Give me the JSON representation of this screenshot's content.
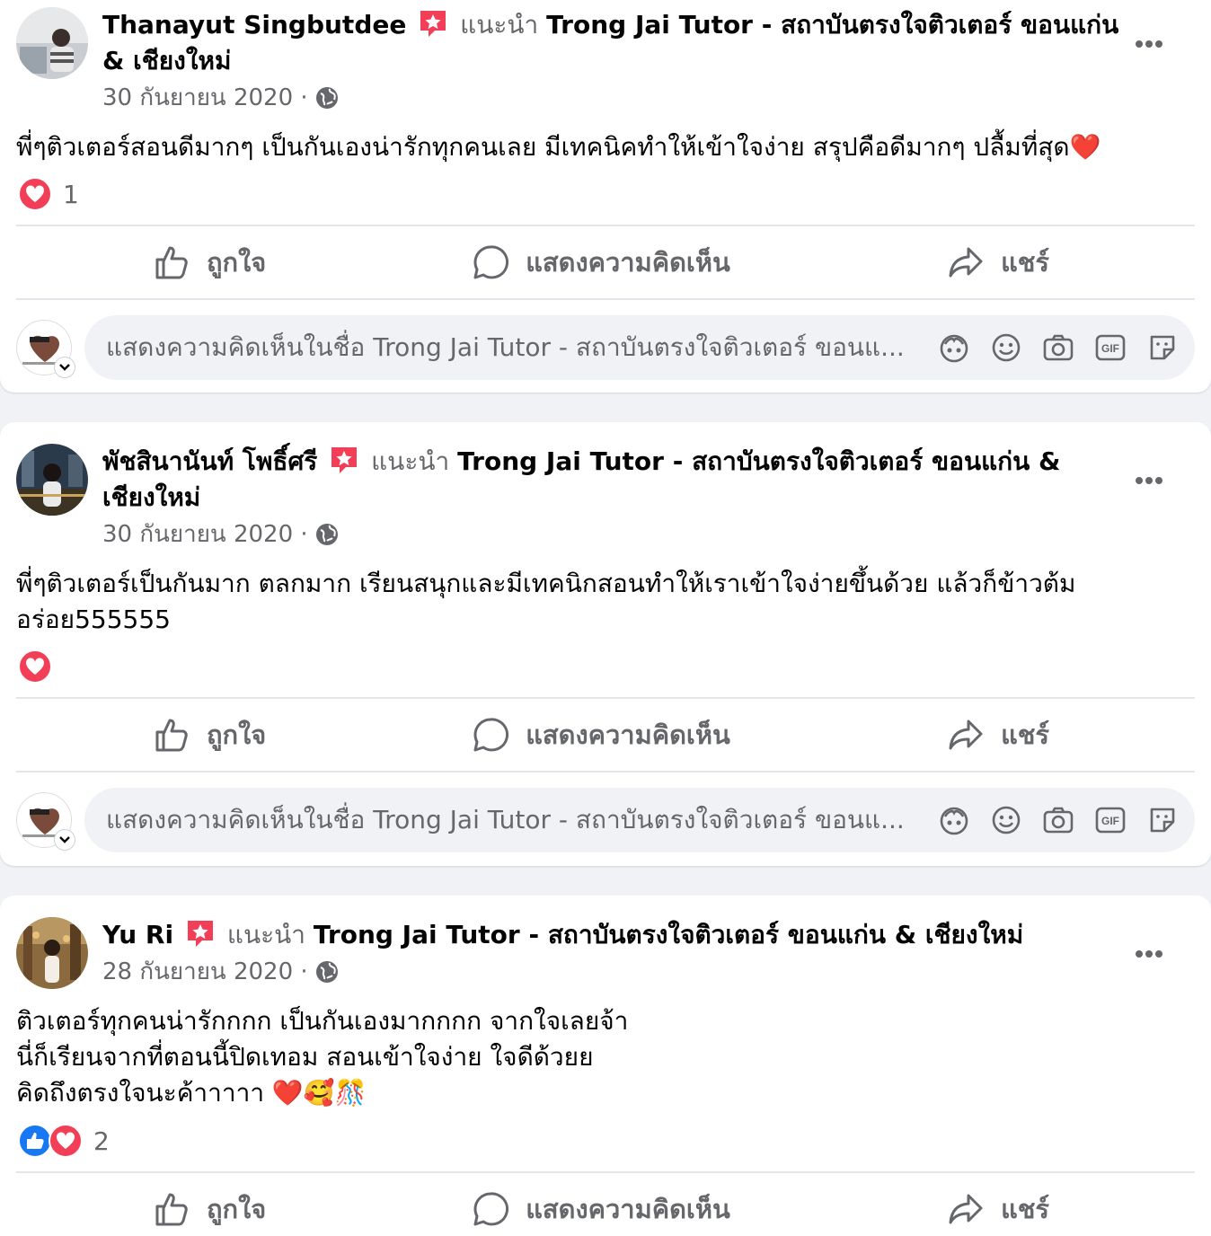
{
  "labels": {
    "recommends": "แนะนำ",
    "page_name": "Trong Jai Tutor - สถาบันตรงใจติวเตอร์ ขอนแก่น & เชียงใหม่",
    "like": "ถูกใจ",
    "comment": "แสดงความคิดเห็น",
    "share": "แชร์",
    "composer_placeholder": "แสดงความคิดเห็นในชื่อ Trong Jai Tutor - สถาบันตรงใจติวเตอร์ ขอนแ..."
  },
  "posts": [
    {
      "author": "Thanayut Singbutdee",
      "date": "30 กันยายน 2020 ·",
      "text": "พี่ๆติวเตอร์สอนดีมากๆ เป็นกันเองน่ารักทุกคนเลย มีเทคนิคทำให้เข้าใจง่าย สรุปคือดีมากๆ ปลื้มที่สุด❤️",
      "reactions": [
        "love"
      ],
      "reaction_count": "1"
    },
    {
      "author": "พัชสินานันท์ โพธิ์ศรี",
      "date": "30 กันยายน 2020 ·",
      "text": "พี่ๆติวเตอร์เป็นกันมาก ตลกมาก เรียนสนุกและมีเทคนิกสอนทำให้เราเข้าใจง่ายขึ้นด้วย แล้วก็ข้าวต้ม\nอร่อย555555",
      "reactions": [
        "love"
      ],
      "reaction_count": ""
    },
    {
      "author": "Yu Ri",
      "date": "28 กันยายน 2020 ·",
      "text": "ติวเตอร์ทุกคนน่ารักกกก เป็นกันเองมากกกก จากใจเลยจ้า\nนี่ก็เรียนจากที่ตอนนี้ปิดเทอม สอนเข้าใจง่าย ใจดีด้วยย\nคิดถึงตรงใจนะค้าาาาา ❤️🥰🎊",
      "reactions": [
        "like",
        "love"
      ],
      "reaction_count": "2"
    }
  ],
  "colors": {
    "secondary_text": "#65676b",
    "love": "#f33e58",
    "like": "#1877f2",
    "divider": "#e4e6eb",
    "page_bg": "#f0f2f5"
  },
  "icons": [
    "recommend-badge-icon",
    "globe-icon",
    "more-icon",
    "like-icon",
    "comment-icon",
    "share-icon",
    "avatar-icon",
    "emoji-icon",
    "camera-icon",
    "gif-icon",
    "sticker-icon",
    "chevron-down-icon"
  ]
}
